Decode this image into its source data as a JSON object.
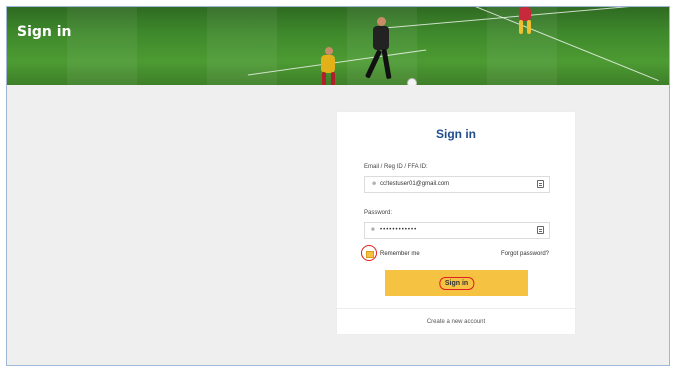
{
  "banner": {
    "title": "Sign in"
  },
  "form": {
    "title": "Sign in",
    "email": {
      "label": "Email / Reg ID / FFA ID:",
      "value": "cc!testuser01@gmail.com",
      "lead_icon": "user-icon",
      "trail_icon": "contact-card-icon"
    },
    "password": {
      "label": "Password:",
      "value": "••••••••••••",
      "lead_icon": "lock-icon",
      "trail_icon": "contact-card-icon"
    },
    "remember_label": "Remember me",
    "remember_checked": true,
    "forgot_label": "Forgot password?",
    "submit_label": "Sign in",
    "create_account_label": "Create a new account"
  },
  "colors": {
    "accent_button": "#f6c242",
    "title_blue": "#1f4e8c",
    "annotation_red": "#e02020"
  }
}
